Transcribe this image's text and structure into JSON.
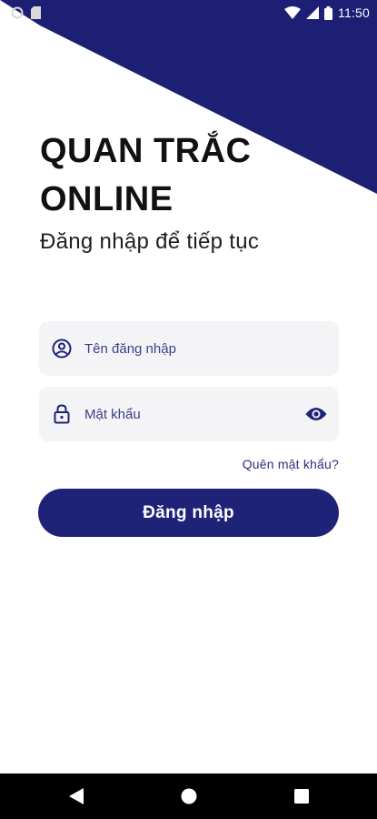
{
  "status_bar": {
    "time": "11:50",
    "icons": [
      "circle-status-icon",
      "sim-card-icon",
      "wifi-icon",
      "signal-icon",
      "battery-icon"
    ]
  },
  "header": {
    "title": "QUAN TRẮC\nONLINE",
    "subtitle": "Đăng nhập để tiếp tục"
  },
  "form": {
    "username_placeholder": "Tên đăng nhập",
    "password_placeholder": "Mật khẩu",
    "username_icon": "account-circle-icon",
    "password_icon": "lock-icon",
    "visibility_icon": "eye-icon",
    "forgot_label": "Quên mật khẩu?",
    "login_label": "Đăng nhập"
  },
  "nav_bar": {
    "icons": [
      "back-triangle-icon",
      "home-circle-icon",
      "recents-square-icon"
    ]
  },
  "colors": {
    "primary": "#1e2378",
    "banner": "#1c1f74",
    "field_bg": "#f4f4f6",
    "text_dark": "#111111"
  }
}
